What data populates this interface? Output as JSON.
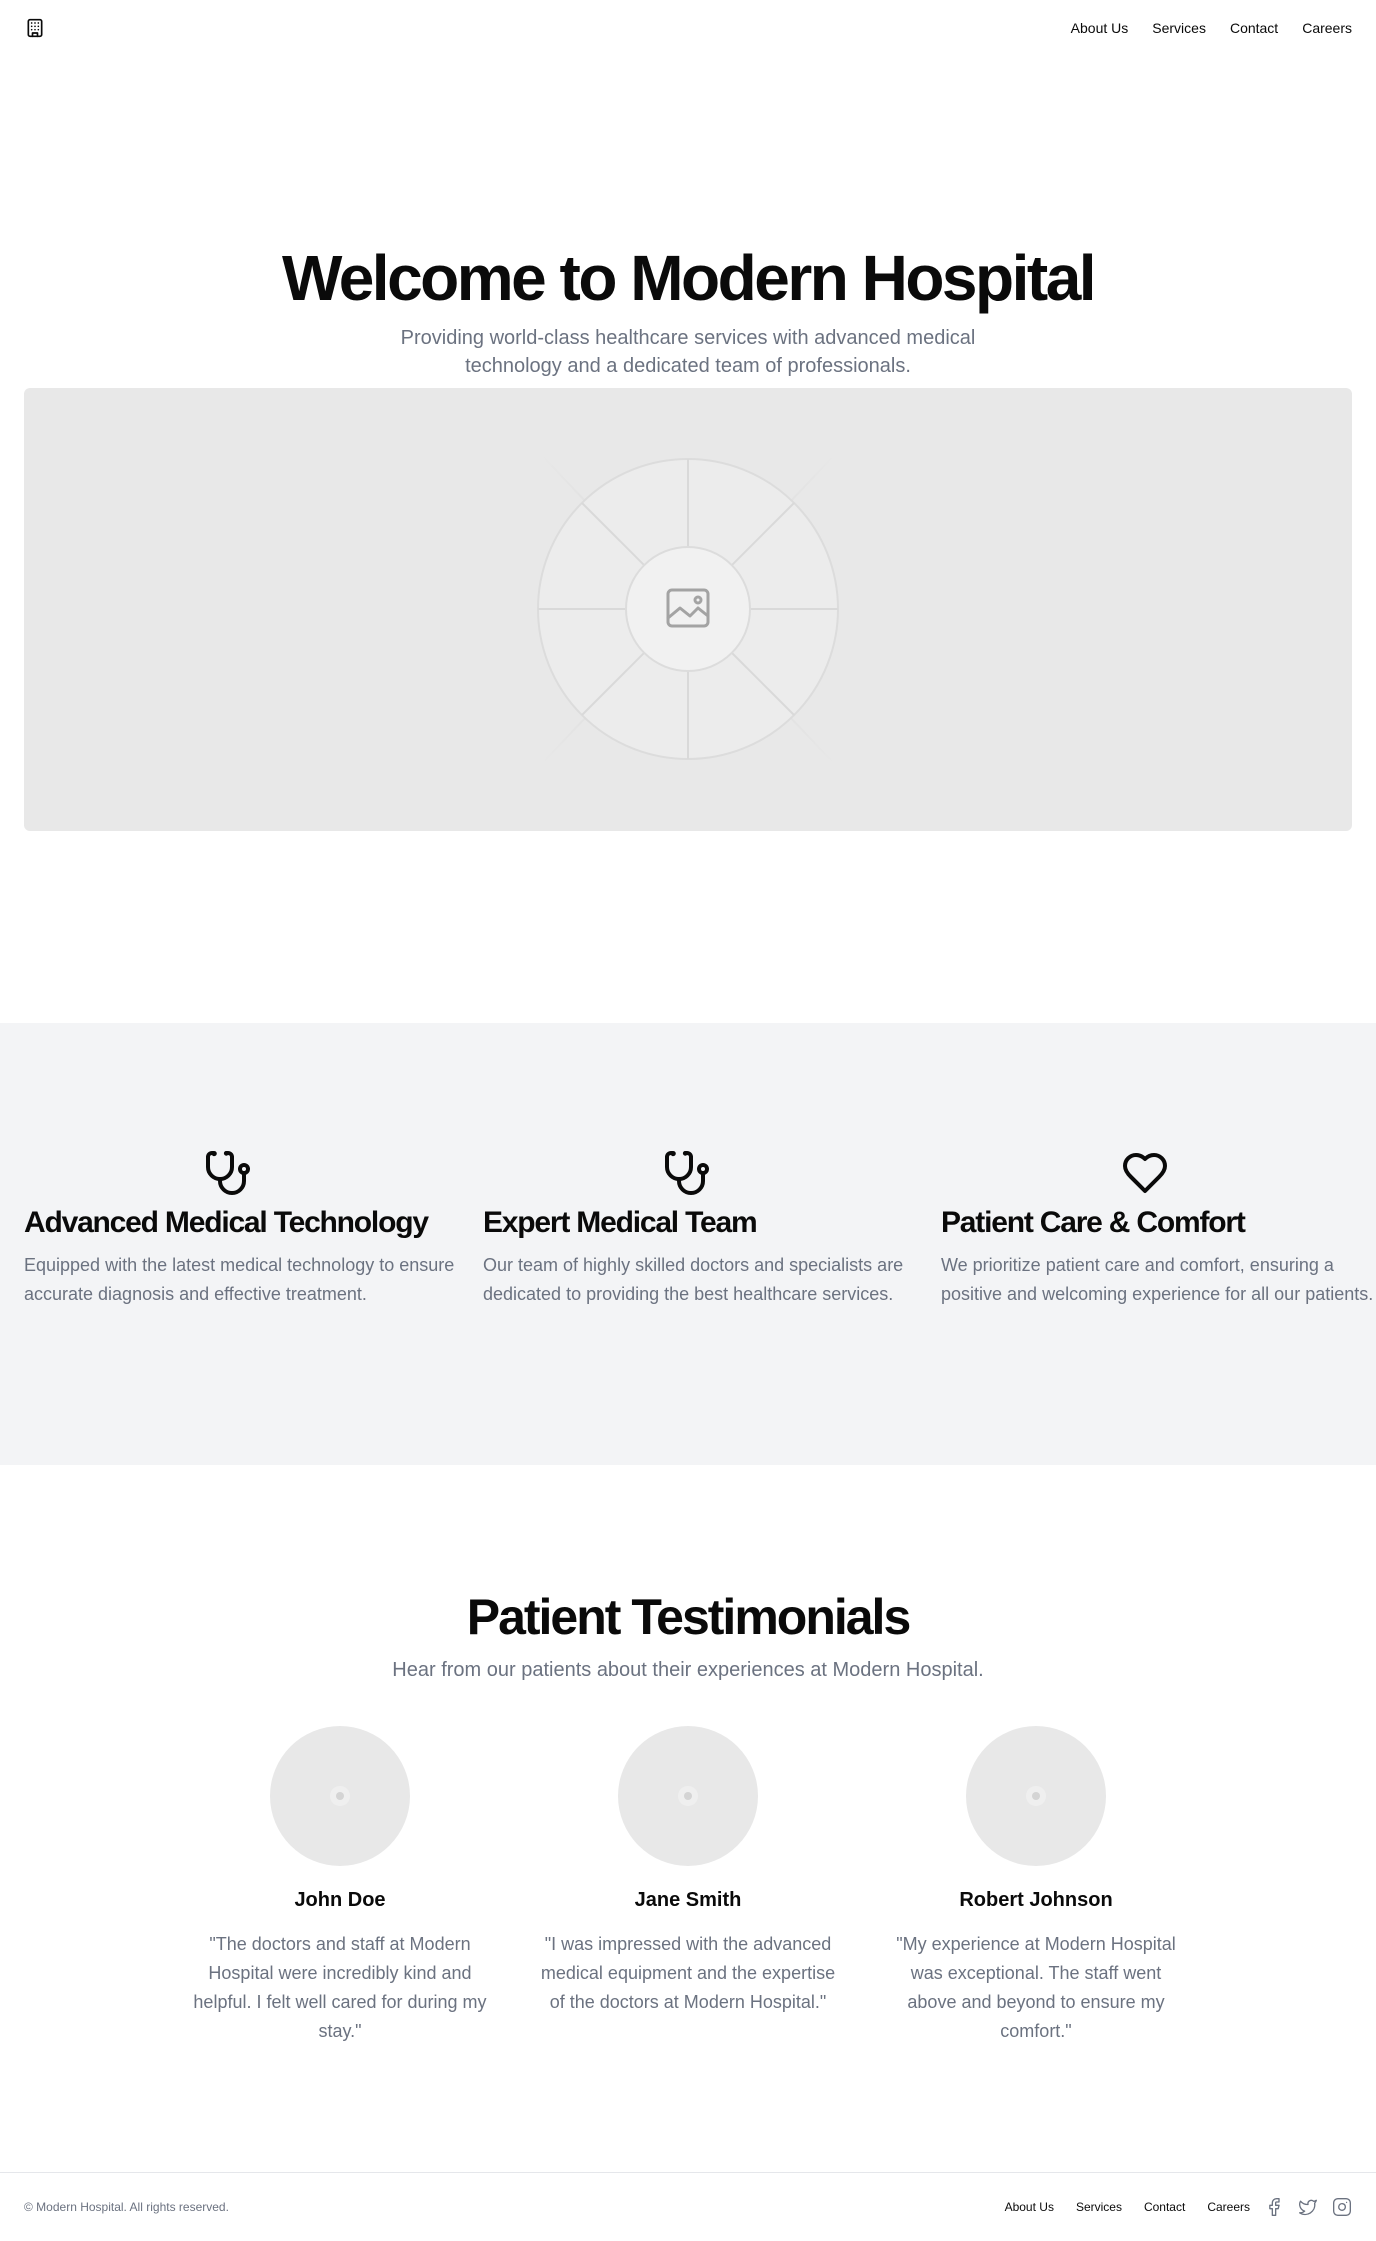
{
  "header": {
    "logo_icon": "hospital-building-icon",
    "nav": [
      {
        "label": "About Us"
      },
      {
        "label": "Services"
      },
      {
        "label": "Contact"
      },
      {
        "label": "Careers"
      }
    ]
  },
  "hero": {
    "title": "Welcome to Modern Hospital",
    "subtitle": "Providing world-class healthcare services with advanced medical technology and a dedicated team of professionals.",
    "image_icon": "image-placeholder-icon"
  },
  "features": [
    {
      "icon": "stethoscope-icon",
      "title": "Advanced Medical Technology",
      "text": "Equipped with the latest medical technology to ensure accurate diagnosis and effective treatment."
    },
    {
      "icon": "stethoscope-icon",
      "title": "Expert Medical Team",
      "text": "Our team of highly skilled doctors and specialists are dedicated to providing the best healthcare services."
    },
    {
      "icon": "heart-icon",
      "title": "Patient Care & Comfort",
      "text": "We prioritize patient care and comfort, ensuring a positive and welcoming experience for all our patients."
    }
  ],
  "testimonials": {
    "title": "Patient Testimonials",
    "subtitle": "Hear from our patients about their experiences at Modern Hospital.",
    "items": [
      {
        "name": "John Doe",
        "quote": "\"The doctors and staff at Modern Hospital were incredibly kind and helpful. I felt well cared for during my stay.\""
      },
      {
        "name": "Jane Smith",
        "quote": "\"I was impressed with the advanced medical equipment and the expertise of the doctors at Modern Hospital.\""
      },
      {
        "name": "Robert Johnson",
        "quote": "\"My experience at Modern Hospital was exceptional. The staff went above and beyond to ensure my comfort.\""
      }
    ]
  },
  "footer": {
    "copyright": "© Modern Hospital. All rights reserved.",
    "nav": [
      {
        "label": "About Us"
      },
      {
        "label": "Services"
      },
      {
        "label": "Contact"
      },
      {
        "label": "Careers"
      }
    ],
    "social_icons": [
      "facebook-icon",
      "twitter-icon",
      "instagram-icon"
    ]
  },
  "colors": {
    "text": "#0a0a0a",
    "muted": "#6b7280",
    "section_bg": "#f3f4f6",
    "placeholder": "#e8e8e8"
  }
}
